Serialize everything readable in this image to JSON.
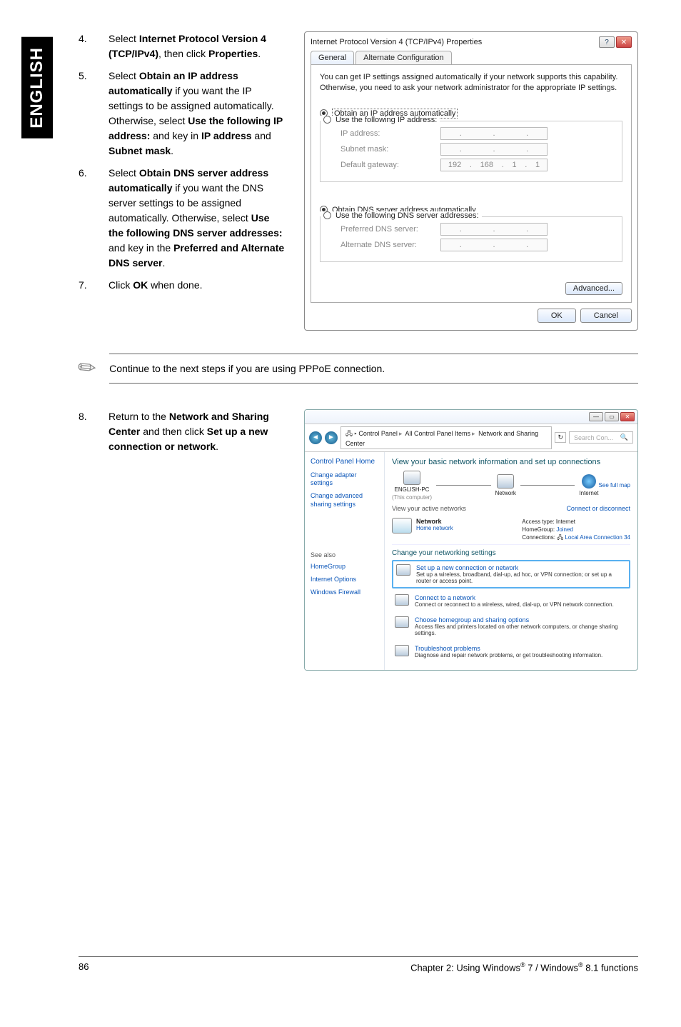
{
  "side_tab": "ENGLISH",
  "steps": {
    "s4": {
      "n": "4.",
      "pre": "Select ",
      "b1": "Internet Protocol Version 4 (TCP/IPv4)",
      "mid": ", then click ",
      "b2": "Properties",
      "post": "."
    },
    "s5": {
      "n": "5.",
      "pre": "Select ",
      "b1": "Obtain an IP address automatically",
      "t2": " if you want the IP settings to be assigned automatically. Otherwise, select ",
      "b2": "Use the following IP address:",
      "t3": " and key in ",
      "b3": "IP address",
      "t4": " and ",
      "b4": "Subnet mask",
      "post": "."
    },
    "s6": {
      "n": "6.",
      "pre": "Select ",
      "b1": "Obtain DNS server address automatically",
      "t2": " if you want the DNS server settings to be assigned automatically. Otherwise, select ",
      "b2": "Use the following DNS server addresses:",
      "t3": " and key in the ",
      "b3": "Preferred and Alternate DNS server",
      "post": "."
    },
    "s7": {
      "n": "7.",
      "pre": "Click ",
      "b1": "OK",
      "post": " when done."
    },
    "s8": {
      "n": "8.",
      "pre": "Return to the ",
      "b1": "Network and Sharing Center",
      "t2": " and then click ",
      "b2": "Set up a new connection or network",
      "post": "."
    }
  },
  "note": "Continue to the next steps if you are using PPPoE connection.",
  "dlg": {
    "title": "Internet Protocol Version 4 (TCP/IPv4) Properties",
    "tab_general": "General",
    "tab_alt": "Alternate Configuration",
    "desc": "You can get IP settings assigned automatically if your network supports this capability. Otherwise, you need to ask your network administrator for the appropriate IP settings.",
    "r_obtain_ip": "Obtain an IP address automatically",
    "r_use_ip": "Use the following IP address:",
    "f_ip": "IP address:",
    "f_mask": "Subnet mask:",
    "f_gw": "Default gateway:",
    "gw_val": [
      "192",
      "168",
      "1",
      "1"
    ],
    "r_obtain_dns": "Obtain DNS server address automatically",
    "r_use_dns": "Use the following DNS server addresses:",
    "f_pdns": "Preferred DNS server:",
    "f_adns": "Alternate DNS server:",
    "advanced": "Advanced...",
    "ok": "OK",
    "cancel": "Cancel",
    "help_glyph": "?",
    "close_glyph": "✕"
  },
  "dlg2": {
    "min_glyph": "—",
    "max_glyph": "▭",
    "close_glyph": "✕",
    "nav_back": "◄",
    "nav_fwd": "►",
    "crumb1": "Control Panel",
    "crumb2": "All Control Panel Items",
    "crumb3": "Network and Sharing Center",
    "search_ph": "Search Con...",
    "search_icon": "🔍",
    "side_home": "Control Panel Home",
    "side_adapter": "Change adapter settings",
    "side_sharing": "Change advanced sharing settings",
    "seealso": "See also",
    "sa1": "HomeGroup",
    "sa2": "Internet Options",
    "sa3": "Windows Firewall",
    "main_hdr": "View your basic network information and set up connections",
    "seefull": "See full map",
    "node1": "ENGLISH-PC",
    "node1b": "(This computer)",
    "node2": "Network",
    "node3": "Internet",
    "active_hdr": "View your active networks",
    "active_link": "Connect or disconnect",
    "net_name": "Network",
    "net_type": "Home network",
    "kv_access_l": "Access type:",
    "kv_access_v": "Internet",
    "kv_hg_l": "HomeGroup:",
    "kv_hg_v": "Joined",
    "kv_conn_l": "Connections:",
    "kv_conn_v": "Local Area Connection 34",
    "change_hdr": "Change your networking settings",
    "opt1_t": "Set up a new connection or network",
    "opt1_d": "Set up a wireless, broadband, dial-up, ad hoc, or VPN connection; or set up a router or access point.",
    "opt2_t": "Connect to a network",
    "opt2_d": "Connect or reconnect to a wireless, wired, dial-up, or VPN network connection.",
    "opt3_t": "Choose homegroup and sharing options",
    "opt3_d": "Access files and printers located on other network computers, or change sharing settings.",
    "opt4_t": "Troubleshoot problems",
    "opt4_d": "Diagnose and repair network problems, or get troubleshooting information."
  },
  "footer": {
    "page": "86",
    "chapter_pre": "Chapter 2: Using Windows",
    "reg": "®",
    "v1": " 7 / Windows",
    "v2": " 8.1 functions"
  }
}
